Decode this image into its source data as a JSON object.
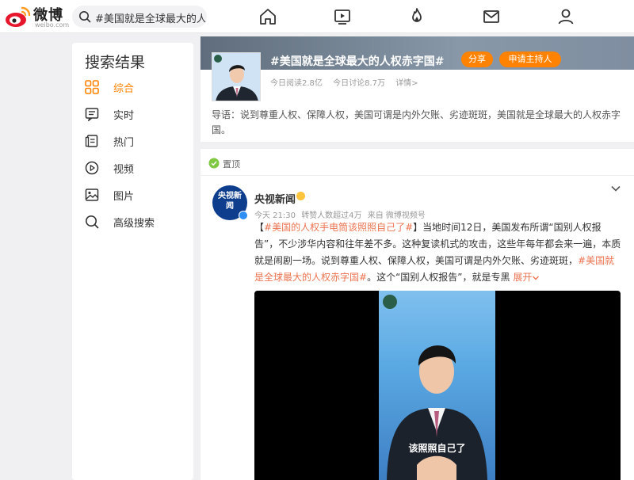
{
  "header": {
    "logo_text": "微博",
    "logo_sub": "weibo.com",
    "search_query": "#美国就是全球最大的人权赤字国#",
    "nav_icons": [
      "home-icon",
      "video-icon",
      "hot-icon",
      "mail-icon",
      "user-icon"
    ]
  },
  "sidebar": {
    "title": "搜索结果",
    "items": [
      {
        "label": "综合",
        "icon": "grid-icon",
        "active": true
      },
      {
        "label": "实时",
        "icon": "realtime-icon",
        "active": false
      },
      {
        "label": "热门",
        "icon": "hot-list-icon",
        "active": false
      },
      {
        "label": "视频",
        "icon": "play-icon",
        "active": false
      },
      {
        "label": "图片",
        "icon": "image-icon",
        "active": false
      },
      {
        "label": "高级搜索",
        "icon": "advanced-search-icon",
        "active": false
      }
    ]
  },
  "topic": {
    "title": "#美国就是全球最大的人权赤字国#",
    "share_label": "分享",
    "host_label": "申请主持人",
    "reads": "今日阅读2.8亿",
    "discussions": "今日讨论8.7万",
    "details": "详情>",
    "intro": "导语：说到尊重人权、保障人权，美国可谓是内外欠账、劣迹斑斑，美国就是全球最大的人权赤字国。"
  },
  "post": {
    "pinned_label": "置顶",
    "avatar_text": "央视新闻",
    "username": "央视新闻",
    "time": "今天 21:30",
    "reposts": "转赞人数超过4万",
    "source": "来自 微博视频号",
    "body_pre": "【",
    "body_tag1": "#美国的人权手电筒该照照自己了#",
    "body_mid": "】当地时间12日，美国发布所谓“国别人权报告”，不少涉华内容和往年差不多。这种复读机式的攻击，这些年每年都会来一遍，本质就是闹剧一场。说到尊重人权、保障人权，美国可谓是内外欠账、劣迹斑斑，",
    "body_tag2": "#美国就是全球最大的人权赤字国#",
    "body_post": "。这个“国别人权报告”，就是专黑",
    "expand_label": "展开",
    "video_caption": "该照照自己了"
  },
  "colors": {
    "accent": "#ff8200",
    "link": "#eb7350",
    "verify": "#2e8ef5"
  }
}
